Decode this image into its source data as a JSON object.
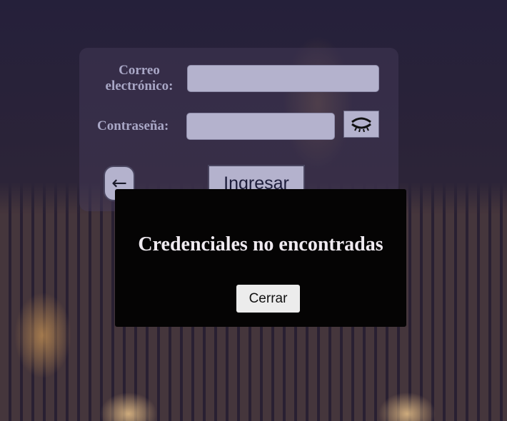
{
  "form": {
    "email_label_line1": "Correo",
    "email_label_line2": "electrónico:",
    "email_value": "",
    "password_label": "Contraseña:",
    "password_value": "",
    "toggle_icon": "eye-closed-icon",
    "back_label": "←",
    "submit_label": "Ingresar"
  },
  "modal": {
    "message": "Credenciales no encontradas",
    "close_label": "Cerrar"
  }
}
